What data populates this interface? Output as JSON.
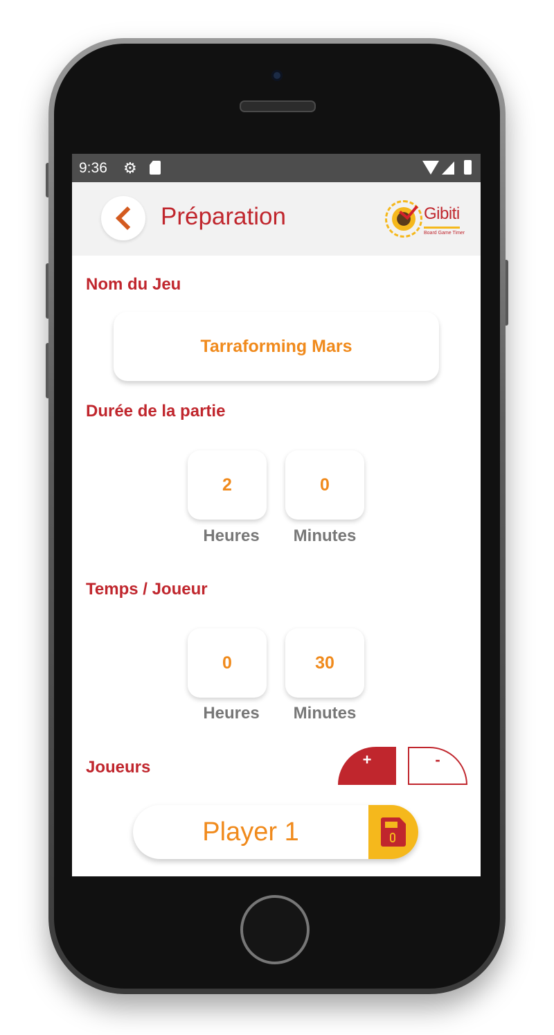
{
  "statusbar": {
    "time": "9:36",
    "icons": [
      "gear-icon",
      "sd-card-icon",
      "wifi-icon",
      "signal-icon",
      "battery-icon"
    ]
  },
  "header": {
    "title": "Préparation",
    "back_icon": "chevron-left-icon",
    "logo": {
      "brand": "Gibiti",
      "tagline": "Board Game Timer"
    }
  },
  "game_section": {
    "label": "Nom du Jeu",
    "value": "Tarraforming Mars"
  },
  "duration_section": {
    "label": "Durée de la partie",
    "hours": "2",
    "minutes": "0",
    "hours_label": "Heures",
    "minutes_label": "Minutes"
  },
  "time_per_player_section": {
    "label": "Temps / Joueur",
    "hours": "0",
    "minutes": "30",
    "hours_label": "Heures",
    "minutes_label": "Minutes"
  },
  "players_section": {
    "label": "Joueurs",
    "add_label": "+",
    "remove_label": "-",
    "players": [
      {
        "name": "Player 1"
      }
    ]
  },
  "colors": {
    "primary_red": "#c0262d",
    "accent_orange": "#f08a1c",
    "accent_yellow": "#f5b81c",
    "muted_gray": "#777777"
  }
}
